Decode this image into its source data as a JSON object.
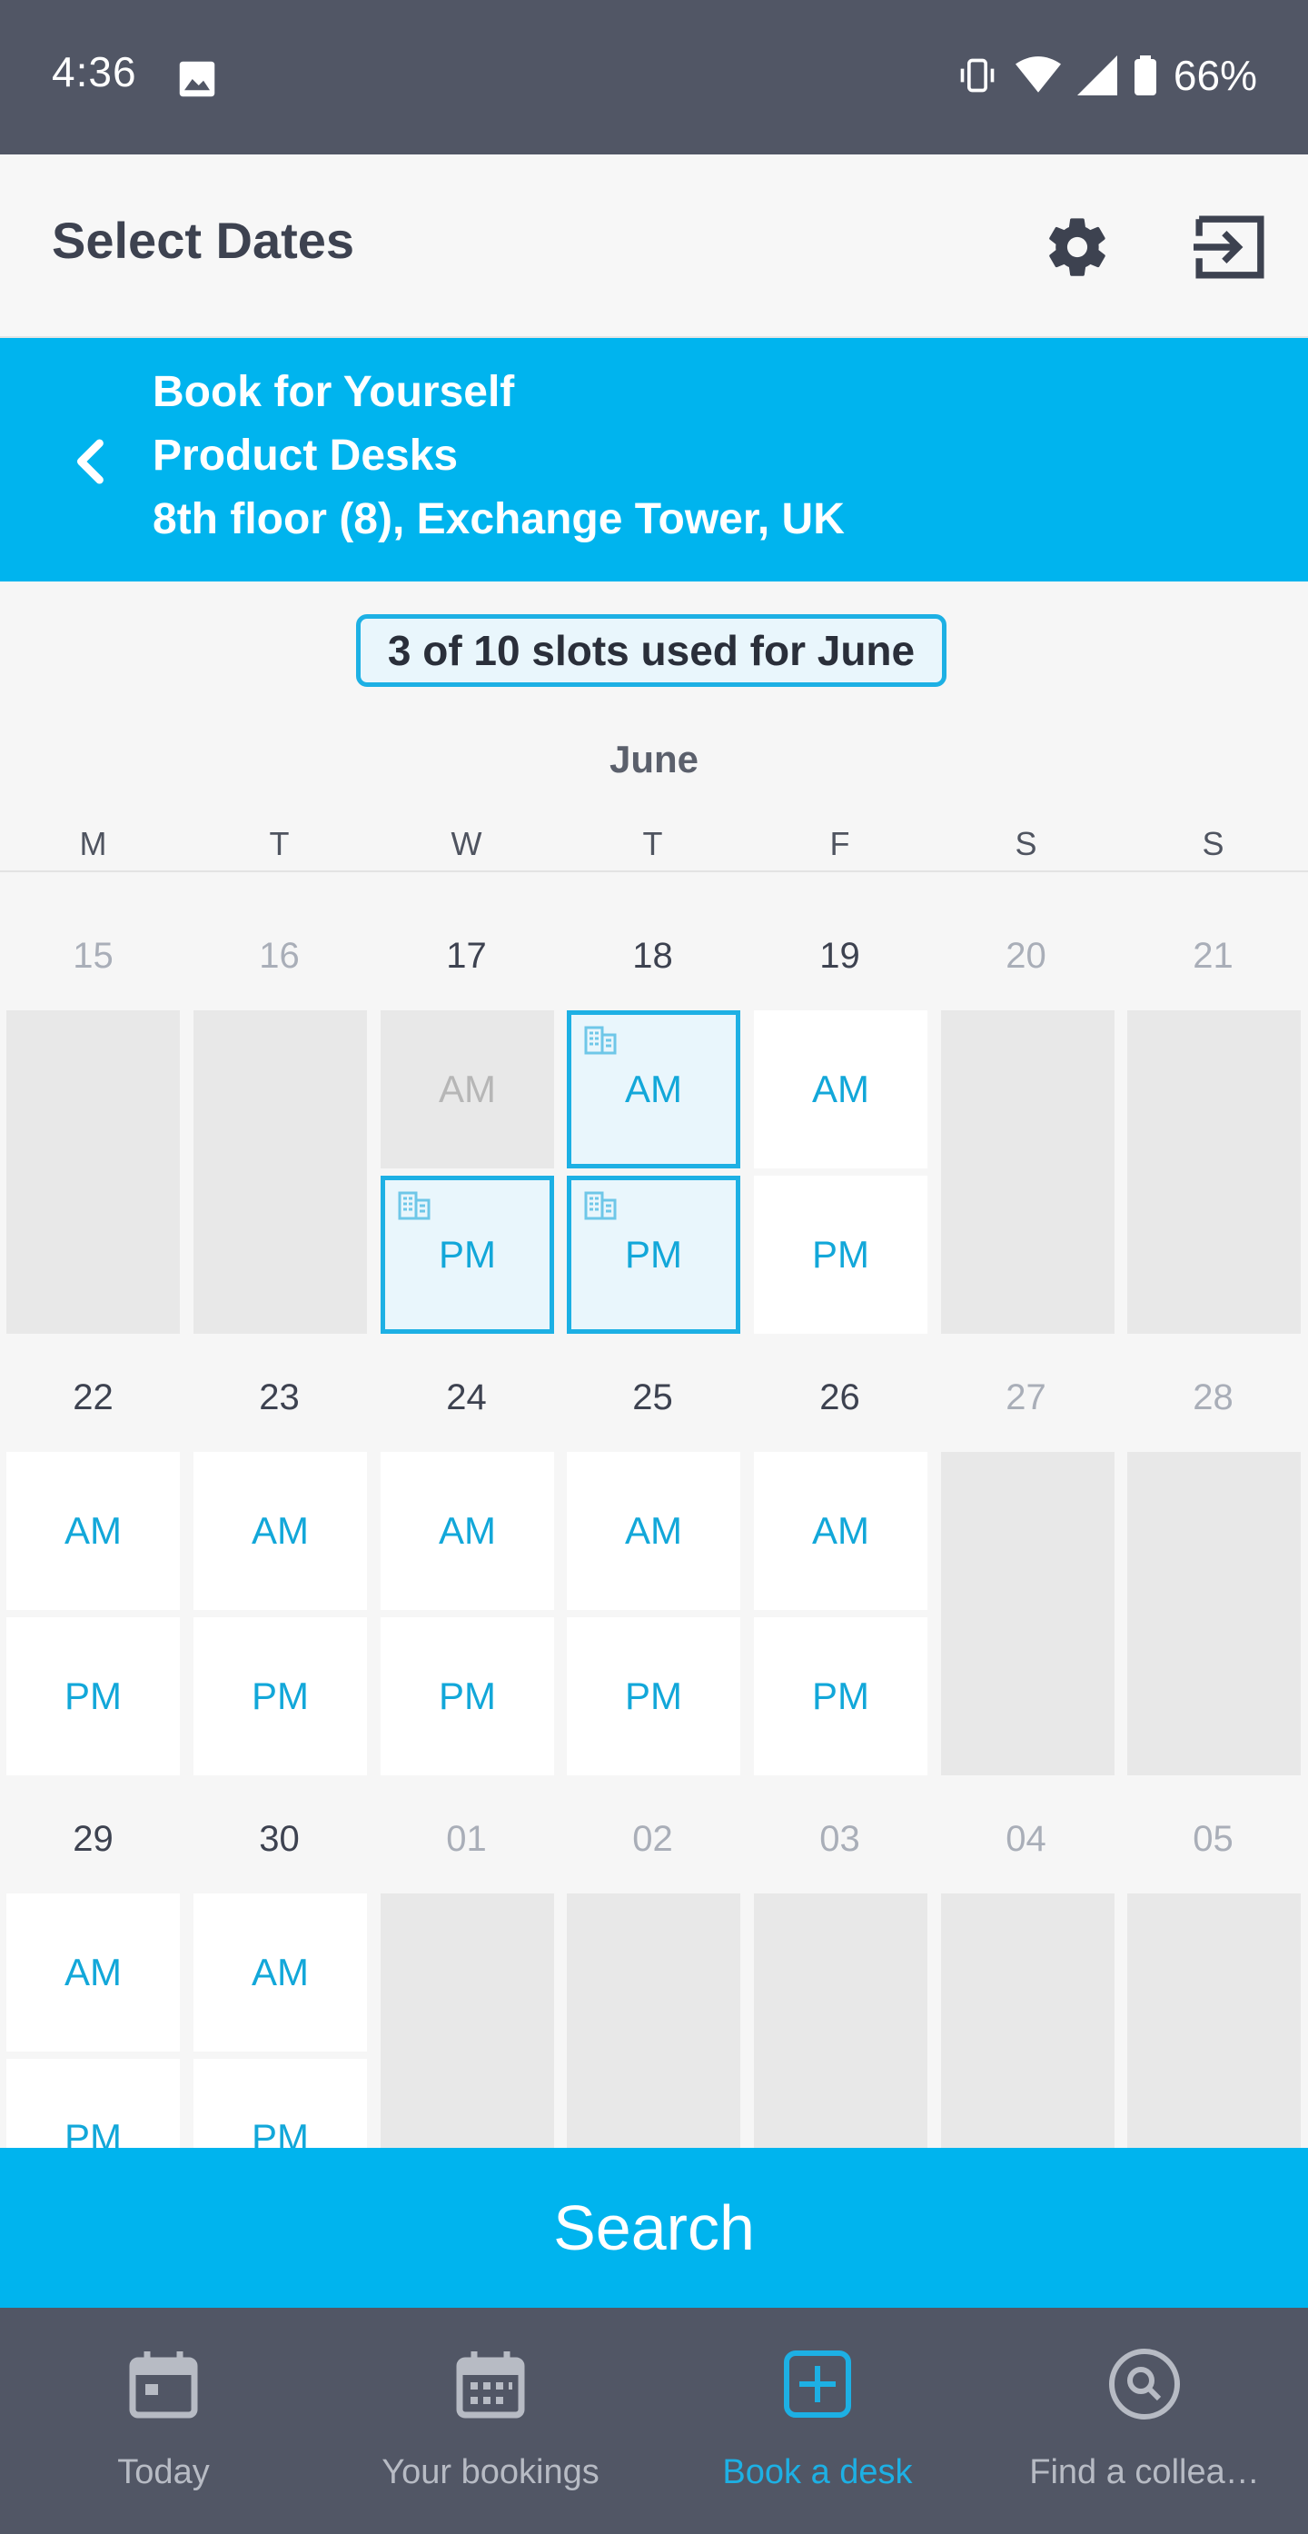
{
  "status_bar": {
    "time": "4:36",
    "battery": "66%"
  },
  "app_bar": {
    "title": "Select Dates",
    "settings_icon": "gear-icon",
    "exit_icon": "exit-icon"
  },
  "context": {
    "line1": "Book for Yourself",
    "line2": "Product Desks",
    "line3": "8th floor (8), Exchange Tower, UK"
  },
  "slots_badge": "3 of 10 slots used for June",
  "calendar": {
    "month": "June",
    "weekdays": [
      "M",
      "T",
      "W",
      "T",
      "F",
      "S",
      "S"
    ],
    "weeks": [
      {
        "dates": [
          "15",
          "16",
          "17",
          "18",
          "19",
          "20",
          "21"
        ]
      },
      {
        "dates": [
          "22",
          "23",
          "24",
          "25",
          "26",
          "27",
          "28"
        ]
      },
      {
        "dates": [
          "29",
          "30",
          "01",
          "02",
          "03",
          "04",
          "05"
        ]
      }
    ],
    "am_label": "AM",
    "pm_label": "PM"
  },
  "search_button": "Search",
  "bottom_nav": [
    {
      "label": "Today",
      "icon": "calendar-day-icon",
      "active": false
    },
    {
      "label": "Your bookings",
      "icon": "calendar-grid-icon",
      "active": false
    },
    {
      "label": "Book a desk",
      "icon": "plus-square-icon",
      "active": true
    },
    {
      "label": "Find a collea…",
      "icon": "search-circle-icon",
      "active": false
    }
  ],
  "colors": {
    "accent": "#00b4ee",
    "dark_bar": "#515665",
    "selected_border": "#1db0e4"
  }
}
